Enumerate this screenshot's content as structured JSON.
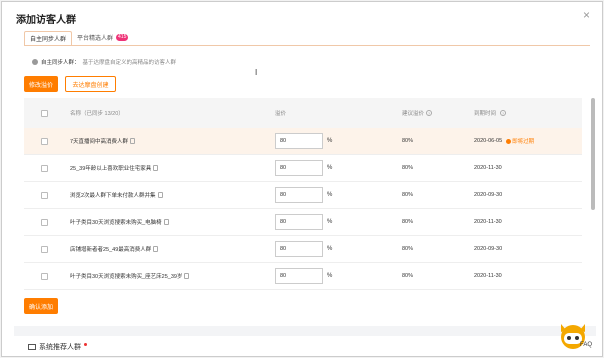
{
  "modal": {
    "title": "添加访客人群",
    "close": "×"
  },
  "tabs": [
    {
      "label": "自主同步人群",
      "active": true
    },
    {
      "label": "平台精选人群",
      "badge": "415",
      "active": false
    }
  ],
  "hint": {
    "strong": "自主同步人群：",
    "muted": "基于达摩盘自定义的高精品的访客人群"
  },
  "actions": {
    "edit_price": "修改溢价",
    "new_from_dmp": "去达摩盘创建"
  },
  "table": {
    "headers": {
      "name": "名称（已同步 13/20）",
      "price": "溢价",
      "suggested": "建议溢价",
      "expiry": "到期时间"
    },
    "rows": [
      {
        "name": "7天直播间中高消费人群",
        "price": "80",
        "unit": "%",
        "suggested": "80%",
        "expiry": "2020-06-05",
        "expiring": "即将过期",
        "highlight": true
      },
      {
        "name": "25_39年龄以上喜欢职业住宅家具",
        "price": "80",
        "unit": "%",
        "suggested": "80%",
        "expiry": "2020-11-30",
        "expiring": "",
        "highlight": false
      },
      {
        "name": "浏览2次最人群下单未付款人群并集",
        "price": "80",
        "unit": "%",
        "suggested": "80%",
        "expiry": "2020-09-30",
        "expiring": "",
        "highlight": false
      },
      {
        "name": "叶子类目30天浏览搜索未购买_电脑椅",
        "price": "80",
        "unit": "%",
        "suggested": "80%",
        "expiry": "2020-11-30",
        "expiring": "",
        "highlight": false
      },
      {
        "name": "店铺增新者者25_49最高消费人群",
        "price": "80",
        "unit": "%",
        "suggested": "80%",
        "expiry": "2020-09-30",
        "expiring": "",
        "highlight": false
      },
      {
        "name": "叶子类目30天浏览搜索未购买_座艺床25_39岁",
        "price": "80",
        "unit": "%",
        "suggested": "80%",
        "expiry": "2020-11-30",
        "expiring": "",
        "highlight": false
      }
    ]
  },
  "confirm_add": "确认添加",
  "recommend": "系统推荐人群",
  "faq": "FAQ",
  "colors": {
    "accent": "#ff7d00",
    "badge": "#ee3377",
    "highlight_row": "#fdf3ea"
  },
  "icons": [
    "close-icon",
    "info-icon",
    "doc-icon",
    "question-icon",
    "warning-icon",
    "monitor-icon",
    "mascot-icon"
  ]
}
